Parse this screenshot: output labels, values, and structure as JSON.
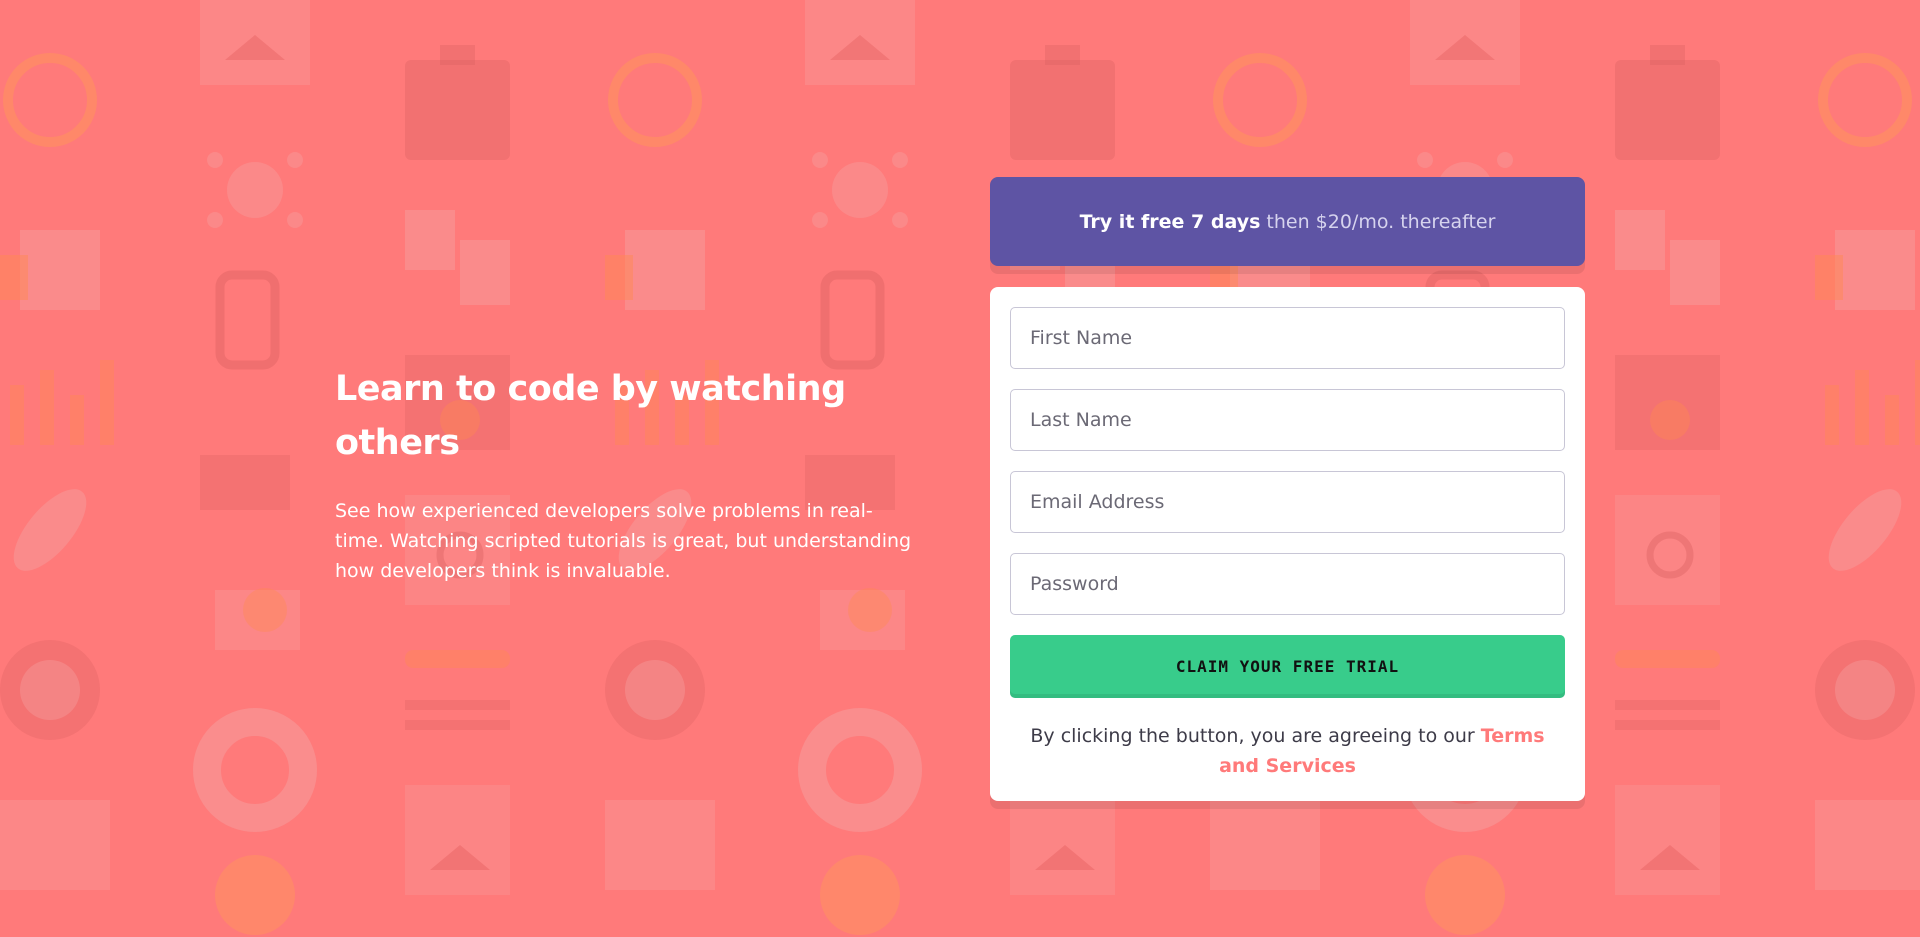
{
  "hero": {
    "title": "Learn to code by watching others",
    "description": "See how experienced developers solve problems in real-time. Watching scripted tutorials is great, but understanding how developers think is invaluable."
  },
  "offer": {
    "strong": "Try it free 7 days",
    "rest": "then $20/mo. thereafter"
  },
  "form": {
    "first_name_placeholder": "First Name",
    "last_name_placeholder": "Last Name",
    "email_placeholder": "Email Address",
    "password_placeholder": "Password",
    "submit_label": "CLAIM YOUR FREE TRIAL",
    "terms_text": "By clicking the button, you are agreeing to our",
    "terms_link": "Terms and Services"
  },
  "colors": {
    "background": "#ff7a7a",
    "offer_bg": "#5e54a4",
    "cta": "#38cc8b",
    "link": "#ff7a7a"
  }
}
